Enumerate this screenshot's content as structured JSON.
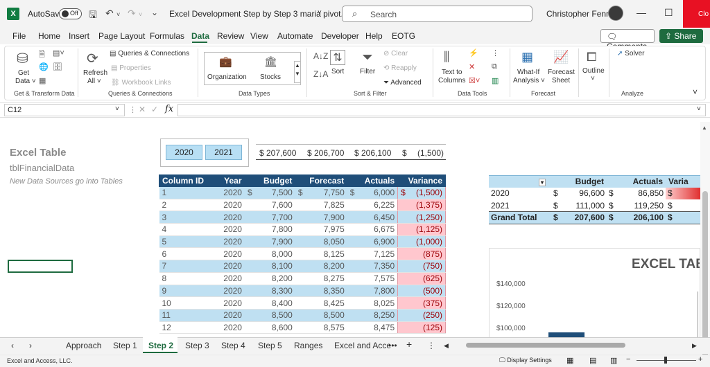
{
  "titlebar": {
    "app_icon": "X",
    "autosave_label": "AutoSave",
    "autosave_state": "Off",
    "doc_title": "Excel Development Step by Step 3  maria pivot...",
    "search_placeholder": "Search",
    "user_name": "Christopher Fennell",
    "close_label": "Clo"
  },
  "menu": [
    "File",
    "Home",
    "Insert",
    "Page Layout",
    "Formulas",
    "Data",
    "Review",
    "View",
    "Automate",
    "Developer",
    "Help",
    "EOTG"
  ],
  "menu_active": "Data",
  "comments_label": "Comments",
  "share_label": "Share",
  "ribbon": {
    "get_data": "Get",
    "get_data2": "Data ˅",
    "refresh": "Refresh",
    "refresh2": "All ˅",
    "queries": "Queries & Connections",
    "properties": "Properties",
    "workbook_links": "Workbook Links",
    "organization": "Organization",
    "stocks": "Stocks",
    "sort": "Sort",
    "filter": "Filter",
    "clear": "Clear",
    "reapply": "Reapply",
    "advanced": "Advanced",
    "text_to": "Text to",
    "columns": "Columns",
    "whatif": "What-If",
    "analysis": "Analysis ˅",
    "forecast": "Forecast",
    "sheet": "Sheet",
    "outline": "Outline",
    "solver": "Solver",
    "groups": {
      "get_transform": "Get & Transform Data",
      "queries_conn": "Queries & Connections",
      "data_types": "Data Types",
      "sort_filter": "Sort & Filter",
      "data_tools": "Data Tools",
      "forecast": "Forecast",
      "analyze": "Analyze"
    }
  },
  "formula_bar": {
    "name_box": "C12",
    "fx": "fx",
    "formula": ""
  },
  "sheet": {
    "title": "Excel Table",
    "subtitle": "tblFinancialData",
    "note": "New Data Sources go into Tables",
    "slicer": [
      "2020",
      "2021"
    ],
    "kpi": [
      "$ 207,600",
      "$ 206,700",
      "$ 206,100",
      "$",
      "(1,500)"
    ]
  },
  "main_table": {
    "headers": [
      "Column ID",
      "Year",
      "Budget",
      "Forecast",
      "Actuals",
      "Variance"
    ],
    "rows": [
      [
        "1",
        "2020",
        "$",
        "7,500",
        "$",
        "7,750",
        "$",
        "6,000",
        "$",
        "(1,500)"
      ],
      [
        "2",
        "2020",
        "",
        "7,600",
        "",
        "7,825",
        "",
        "6,225",
        "",
        "(1,375)"
      ],
      [
        "3",
        "2020",
        "",
        "7,700",
        "",
        "7,900",
        "",
        "6,450",
        "",
        "(1,250)"
      ],
      [
        "4",
        "2020",
        "",
        "7,800",
        "",
        "7,975",
        "",
        "6,675",
        "",
        "(1,125)"
      ],
      [
        "5",
        "2020",
        "",
        "7,900",
        "",
        "8,050",
        "",
        "6,900",
        "",
        "(1,000)"
      ],
      [
        "6",
        "2020",
        "",
        "8,000",
        "",
        "8,125",
        "",
        "7,125",
        "",
        "(875)"
      ],
      [
        "7",
        "2020",
        "",
        "8,100",
        "",
        "8,200",
        "",
        "7,350",
        "",
        "(750)"
      ],
      [
        "8",
        "2020",
        "",
        "8,200",
        "",
        "8,275",
        "",
        "7,575",
        "",
        "(625)"
      ],
      [
        "9",
        "2020",
        "",
        "8,300",
        "",
        "8,350",
        "",
        "7,800",
        "",
        "(500)"
      ],
      [
        "10",
        "2020",
        "",
        "8,400",
        "",
        "8,425",
        "",
        "8,025",
        "",
        "(375)"
      ],
      [
        "11",
        "2020",
        "",
        "8,500",
        "",
        "8,500",
        "",
        "8,250",
        "",
        "(250)"
      ],
      [
        "12",
        "2020",
        "",
        "8,600",
        "",
        "8,575",
        "",
        "8,475",
        "",
        "(125)"
      ]
    ]
  },
  "pivot": {
    "headers": [
      "Budget",
      "Actuals",
      "Varia"
    ],
    "rows": [
      [
        "2020",
        "$",
        "96,600",
        "$",
        "86,850",
        "$"
      ],
      [
        "2021",
        "$",
        "111,000",
        "$",
        "119,250",
        "$"
      ],
      [
        "Grand Total",
        "$",
        "207,600",
        "$",
        "206,100",
        "$"
      ]
    ]
  },
  "chart_data": {
    "type": "bar",
    "title": "EXCEL TAB",
    "ytick_labels": [
      "$140,000",
      "$120,000",
      "$100,000"
    ]
  },
  "tabs": [
    "Approach",
    "Step 1",
    "Step 2",
    "Step 3",
    "Step 4",
    "Step 5",
    "Ranges",
    "Excel and Acce"
  ],
  "active_tab": "Step 2",
  "status": {
    "text": "Excel and Access, LLC.",
    "display_settings": "Display Settings"
  }
}
